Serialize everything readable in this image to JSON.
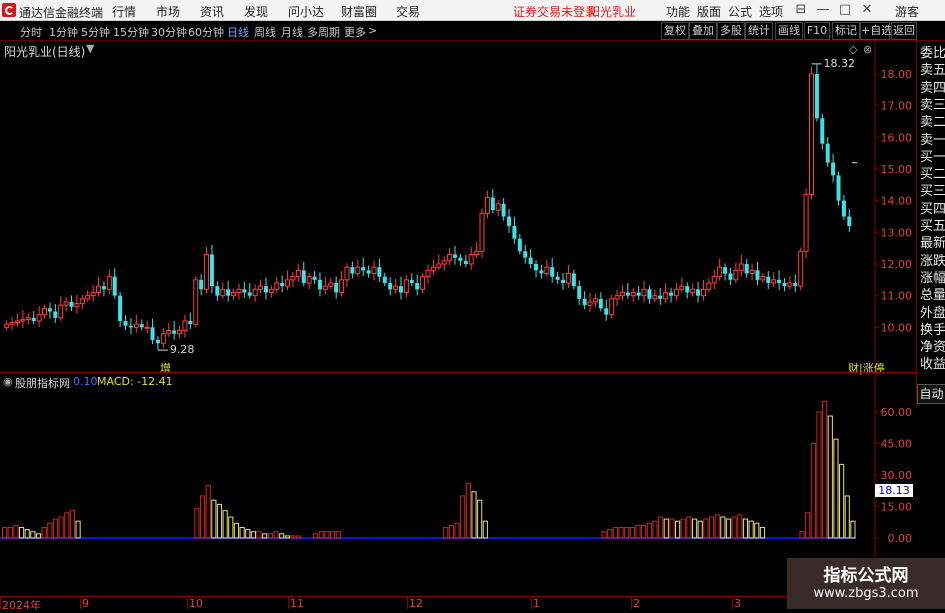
{
  "menubar": {
    "app_title": "通达信金融终端",
    "items": [
      "行情",
      "市场",
      "资讯",
      "发现",
      "问小达",
      "财富圈",
      "交易"
    ],
    "notice": "证券交易未登录",
    "stock_name": "阳光乳业",
    "right_items": [
      "功能",
      "版面",
      "公式",
      "选项"
    ],
    "user": "游客",
    "window_controls": [
      "⊟",
      "—",
      "□",
      "✕"
    ]
  },
  "periodbar": {
    "periods": [
      "分时",
      "1分钟",
      "5分钟",
      "15分钟",
      "30分钟",
      "60分钟",
      "日线",
      "周线",
      "月线",
      "多周期",
      "更多"
    ],
    "active": "日线",
    "tools": [
      "复权",
      "叠加",
      "多股",
      "统计",
      "画线",
      "F10",
      "标记",
      "+自选",
      "返回"
    ]
  },
  "main_chart": {
    "title": "阳光乳业(日线)",
    "high_marker": "18.32",
    "low_marker": "9.28",
    "bottom_tag_left": "增",
    "bottom_tag_right": "财|涨停"
  },
  "sub_chart": {
    "title": "股朋指标网",
    "param": "0.10",
    "macd_label": "MACD: -12.41",
    "current_value": "18.13"
  },
  "right_panel": {
    "items": [
      "委比",
      "卖五",
      "卖四",
      "卖三",
      "卖二",
      "卖一",
      "买一",
      "买二",
      "买三",
      "买四",
      "买五",
      "最新",
      "涨跌",
      "涨幅",
      "总量",
      "外盘",
      "换手",
      "净资",
      "收益"
    ],
    "auto_button": "自动"
  },
  "watermark": {
    "line1": "指标公式网",
    "line2": "www.zbgs3.com"
  },
  "colors": {
    "up": "#ff3c3c",
    "down": "#40e0e8",
    "axis": "#e04040",
    "histogram_up": "#e8e070",
    "histogram_down": "#c8281e",
    "zero_line": "#1010e0"
  },
  "chart_data": [
    {
      "type": "candlestick",
      "title": "阳光乳业(日线)",
      "yaxis_ticks": [
        18.0,
        17.0,
        16.0,
        15.0,
        14.0,
        13.0,
        12.0,
        11.0,
        10.0
      ],
      "ylim": [
        9.0,
        18.6
      ],
      "x_tick_labels": [
        "2024年",
        "9",
        "10",
        "11",
        "12",
        "1",
        "2",
        "3"
      ],
      "annotations": {
        "max": 18.32,
        "min": 9.28
      },
      "close_series": [
        10.1,
        10.15,
        10.2,
        10.25,
        10.3,
        10.2,
        10.4,
        10.6,
        10.5,
        10.3,
        10.7,
        10.8,
        10.65,
        10.75,
        10.9,
        11.0,
        11.1,
        11.3,
        11.2,
        11.6,
        11.0,
        10.2,
        10.05,
        10.0,
        10.1,
        10.0,
        10.0,
        9.6,
        9.5,
        9.8,
        9.9,
        9.8,
        9.9,
        10.2,
        10.1,
        11.5,
        11.2,
        12.3,
        11.3,
        11.0,
        11.2,
        11.0,
        11.1,
        11.2,
        11.1,
        11.0,
        11.2,
        11.3,
        11.1,
        11.2,
        11.4,
        11.3,
        11.5,
        11.6,
        11.8,
        11.4,
        11.6,
        11.5,
        11.2,
        11.3,
        11.4,
        11.1,
        11.5,
        11.9,
        11.7,
        11.9,
        11.8,
        11.7,
        11.9,
        11.6,
        11.4,
        11.2,
        11.3,
        11.1,
        11.5,
        11.4,
        11.2,
        11.6,
        11.8,
        11.9,
        12.0,
        12.1,
        12.3,
        12.2,
        12.1,
        12.0,
        12.3,
        12.4,
        13.6,
        14.1,
        13.7,
        13.9,
        13.5,
        13.2,
        12.8,
        12.4,
        12.2,
        12.0,
        11.8,
        11.7,
        11.9,
        11.6,
        11.5,
        11.4,
        11.7,
        11.3,
        10.9,
        10.7,
        10.8,
        10.9,
        10.6,
        10.4,
        10.9,
        11.0,
        11.1,
        11.0,
        11.1,
        11.0,
        11.2,
        10.9,
        11.0,
        10.9,
        11.1,
        11.0,
        11.2,
        11.3,
        11.1,
        11.2,
        11.0,
        11.2,
        11.4,
        11.6,
        11.9,
        11.7,
        11.5,
        11.8,
        12.0,
        11.7,
        11.8,
        11.5,
        11.6,
        11.4,
        11.5,
        11.4,
        11.3,
        11.4,
        11.3,
        12.4,
        14.2,
        18.0,
        16.6,
        15.8,
        15.2,
        14.8,
        14.0,
        13.5,
        13.2
      ]
    },
    {
      "type": "bar",
      "title": "股朋指标网",
      "label": "MACD: -12.41",
      "yaxis_ticks": [
        60.0,
        45.0,
        30.0,
        15.0,
        0.0
      ],
      "ylim": [
        0,
        68
      ],
      "current": 18.13,
      "values": [
        5,
        5,
        6,
        5,
        4,
        3,
        2,
        5,
        7,
        9,
        10,
        12,
        13,
        8,
        0,
        0,
        0,
        0,
        0,
        0,
        0,
        0,
        0,
        0,
        0,
        0,
        0,
        0,
        0,
        0,
        0,
        0,
        0,
        0,
        14,
        20,
        25,
        18,
        16,
        13,
        10,
        7,
        5,
        4,
        3,
        3,
        2,
        2,
        3,
        2,
        1,
        1,
        1,
        0,
        0,
        2,
        3,
        3,
        3,
        3,
        0,
        0,
        0,
        0,
        0,
        0,
        0,
        0,
        0,
        0,
        0,
        0,
        0,
        0,
        0,
        0,
        0,
        0,
        5,
        6,
        7,
        20,
        26,
        22,
        18,
        8,
        0,
        0,
        0,
        0,
        0,
        0,
        0,
        0,
        0,
        0,
        0,
        0,
        0,
        0,
        0,
        0,
        0,
        0,
        0,
        0,
        3,
        4,
        5,
        5,
        5,
        5,
        6,
        6,
        7,
        8,
        10,
        9,
        9,
        8,
        9,
        10,
        9,
        8,
        9,
        10,
        11,
        10,
        9,
        10,
        11,
        9,
        8,
        7,
        5,
        0,
        0,
        0,
        0,
        0,
        0,
        3,
        12,
        45,
        60,
        65,
        58,
        47,
        35,
        20,
        8
      ],
      "highlight_from": 0
    }
  ]
}
